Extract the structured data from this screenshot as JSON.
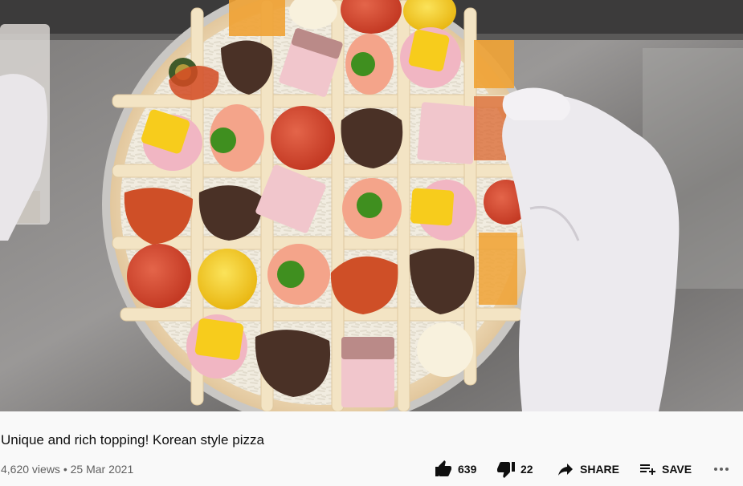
{
  "video": {
    "title": "Unique and rich topping! Korean style pizza",
    "views": "4,620 views",
    "date": "25 Mar 2021",
    "meta_separator": "•"
  },
  "actions": {
    "like_count": "639",
    "dislike_count": "22",
    "share_label": "SHARE",
    "save_label": "SAVE",
    "like_icon": "thumbs-up-icon",
    "dislike_icon": "thumbs-down-icon",
    "share_icon": "share-arrow-icon",
    "save_icon": "playlist-add-icon",
    "more_icon": "more-horizontal-icon"
  },
  "colors": {
    "text_primary": "#0f0f0f",
    "text_secondary": "#606060",
    "background": "#f9f9f9"
  }
}
